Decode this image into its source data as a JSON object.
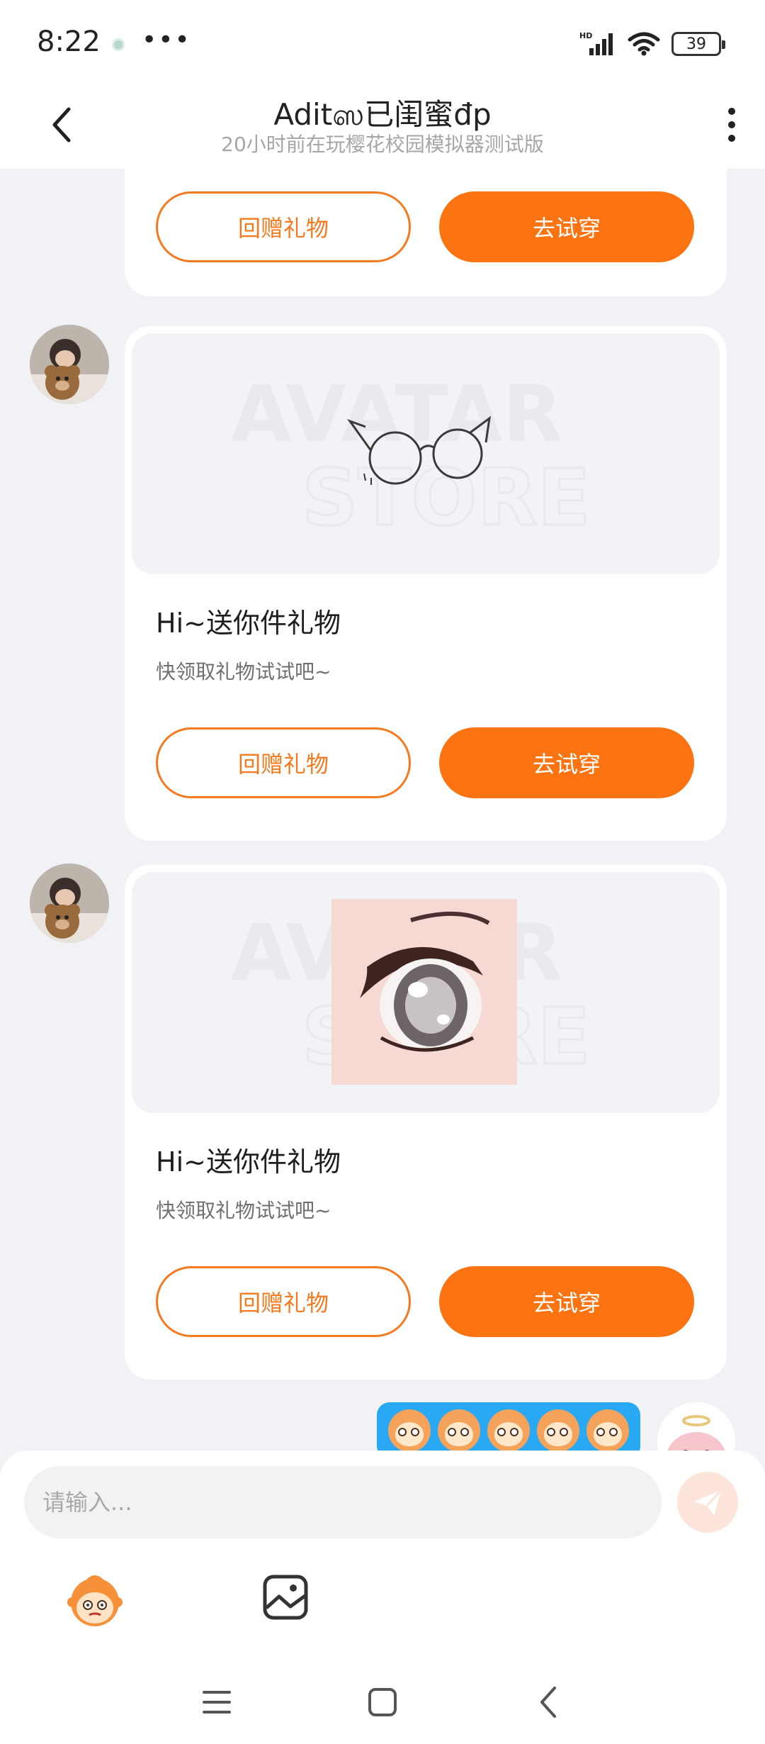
{
  "status_bar": {
    "time": "8:22",
    "more": "•••",
    "network": "HD",
    "battery": "39"
  },
  "header": {
    "title": "Aditஸ已闺蜜đp",
    "subtitle": "20小时前在玩樱花校园模拟器测试版"
  },
  "messages": [
    {
      "type": "gift",
      "title": "",
      "desc": "",
      "return_gift": "回赠礼物",
      "try_on": "去试穿"
    },
    {
      "type": "gift",
      "item": "glasses-icon",
      "title": "Hi~送你件礼物",
      "desc": "快领取礼物试试吧~",
      "return_gift": "回赠礼物",
      "try_on": "去试穿"
    },
    {
      "type": "gift",
      "item": "anime-eye-icon",
      "title": "Hi~送你件礼物",
      "desc": "快领取礼物试试吧~",
      "return_gift": "回赠礼物",
      "try_on": "去试穿"
    }
  ],
  "watermark": {
    "line1": "AVATAR",
    "line2": "STORE"
  },
  "emoji_message": {
    "count": 5
  },
  "composer": {
    "placeholder": "请输入..."
  },
  "colors": {
    "accent": "#fb7411",
    "outline": "#f47a1f",
    "bubble": "#29a8f3",
    "background": "#f1f2f6"
  }
}
